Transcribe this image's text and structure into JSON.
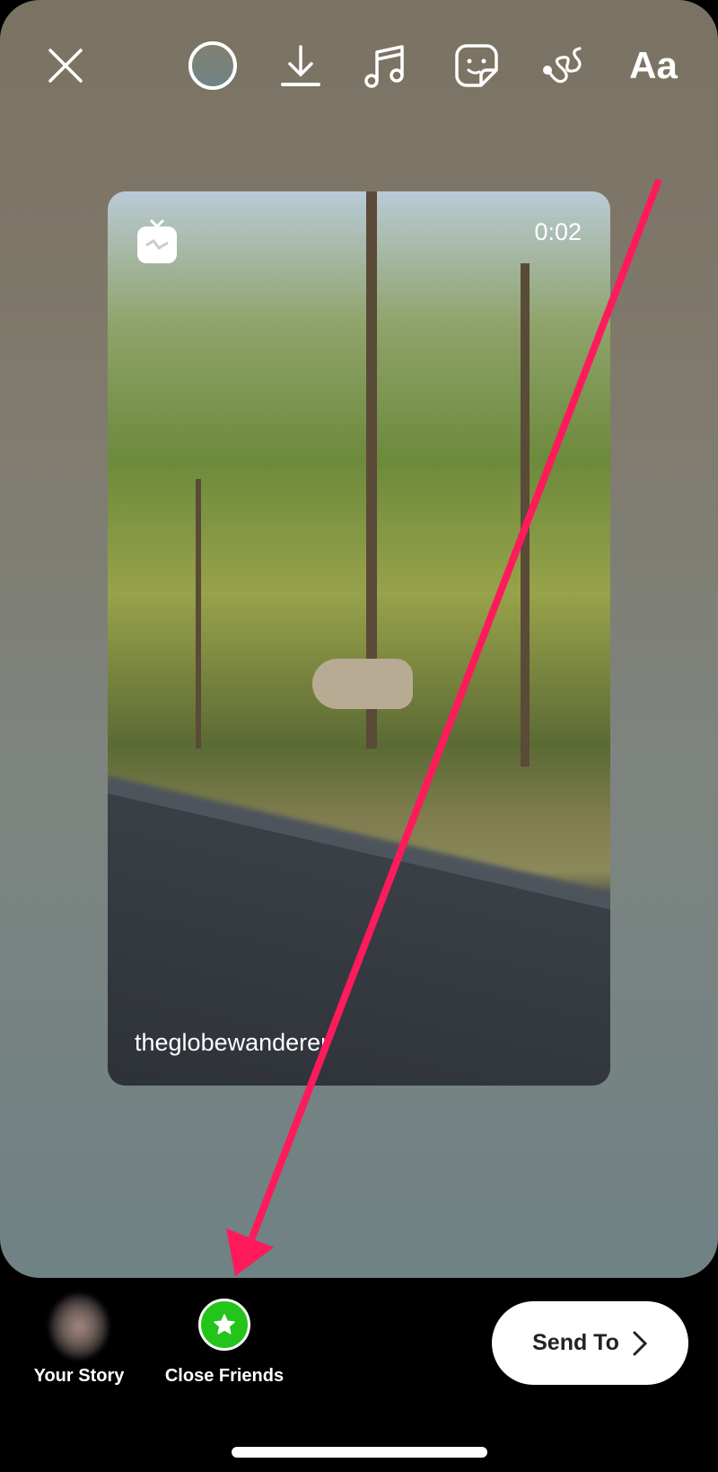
{
  "toolbar": {
    "icons": [
      "close-icon",
      "color-picker-icon",
      "download-icon",
      "music-icon",
      "sticker-icon",
      "draw-icon",
      "text-icon"
    ],
    "text_label": "Aa"
  },
  "card": {
    "badge_icon": "igtv-icon",
    "duration": "0:02",
    "username": "theglobewanderer"
  },
  "annotation": {
    "arrow_color": "#ff1a5c"
  },
  "share": {
    "your_story": "Your Story",
    "close_friends": "Close Friends",
    "close_friends_color": "#23c51a",
    "send_to": "Send To"
  }
}
